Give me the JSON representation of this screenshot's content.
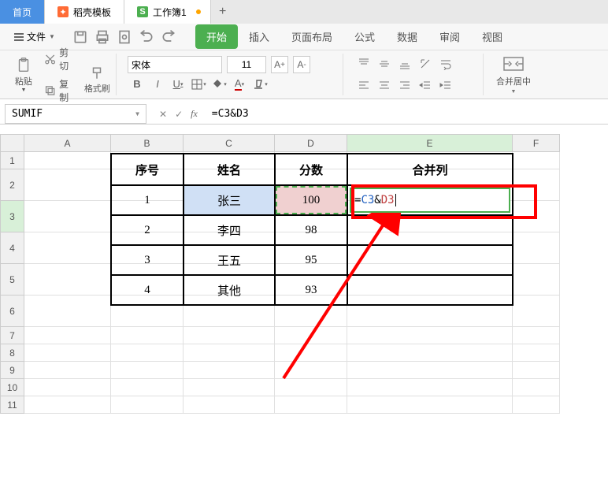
{
  "tabs": {
    "home": "首页",
    "daoke": "稻壳模板",
    "workbook": "工作簿1"
  },
  "menu": {
    "file": "文件"
  },
  "ribbon_tabs": [
    "开始",
    "插入",
    "页面布局",
    "公式",
    "数据",
    "审阅",
    "视图"
  ],
  "ribbon": {
    "cut": "剪切",
    "copy": "复制",
    "paste": "粘贴",
    "format_brush": "格式刷",
    "font_name": "宋体",
    "font_size": "11",
    "merge": "合并居中"
  },
  "namebox": "SUMIF",
  "formula": "=C3&D3",
  "headers": {
    "B": "序号",
    "C": "姓名",
    "D": "分数",
    "E": "合并列"
  },
  "chart_data": {
    "type": "table",
    "columns": [
      "序号",
      "姓名",
      "分数",
      "合并列"
    ],
    "rows": [
      {
        "序号": "1",
        "姓名": "张三",
        "分数": "100",
        "合并列": "=C3&D3"
      },
      {
        "序号": "2",
        "姓名": "李四",
        "分数": "98",
        "合并列": ""
      },
      {
        "序号": "3",
        "姓名": "王五",
        "分数": "95",
        "合并列": ""
      },
      {
        "序号": "4",
        "姓名": "其他",
        "分数": "93",
        "合并列": ""
      }
    ]
  },
  "e3_display": {
    "eq": "=",
    "ref1": "C3",
    "amp": "&",
    "ref2": "D3"
  },
  "col_letters": [
    "A",
    "B",
    "C",
    "D",
    "E",
    "F"
  ],
  "row_nums": [
    "1",
    "2",
    "3",
    "4",
    "5",
    "6",
    "7",
    "8",
    "9",
    "10",
    "11"
  ]
}
